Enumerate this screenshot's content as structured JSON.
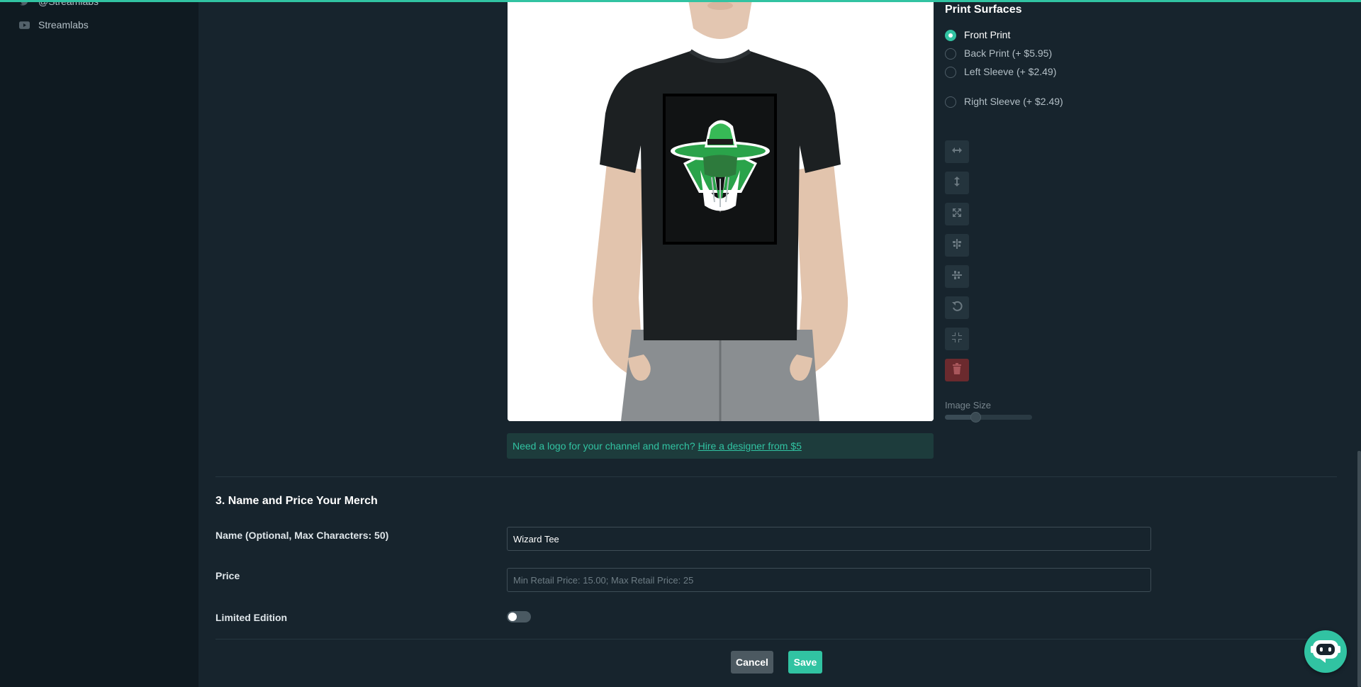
{
  "sidebar": {
    "links": [
      {
        "label": "@Streamlabs",
        "icon": "twitter-icon"
      },
      {
        "label": "Streamlabs",
        "icon": "youtube-icon"
      }
    ]
  },
  "print_surfaces": {
    "title": "Print Surfaces",
    "options": [
      {
        "label": "Front Print",
        "selected": true
      },
      {
        "label": "Back Print (+ $5.95)",
        "selected": false
      },
      {
        "label": "Left Sleeve (+ $2.49)",
        "selected": false
      },
      {
        "label": "Right Sleeve (+ $2.49)",
        "selected": false
      }
    ]
  },
  "toolbar": {
    "tools": [
      "stretch-horizontal-icon",
      "stretch-vertical-icon",
      "expand-icon",
      "align-vertical-center-icon",
      "align-horizontal-center-icon",
      "rotate-icon",
      "compress-icon",
      "trash-icon"
    ]
  },
  "image_size": {
    "label": "Image Size",
    "value": 0.36
  },
  "banner": {
    "text": "Need a logo for your channel and merch?",
    "link": "Hire a designer from $5"
  },
  "section": {
    "title": "3. Name and Price Your Merch",
    "name_label": "Name (Optional, Max Characters: 50)",
    "name_value": "Wizard Tee",
    "price_label": "Price",
    "price_placeholder": "Min Retail Price: 15.00; Max Retail Price: 25",
    "limited_label": "Limited Edition",
    "limited_on": false
  },
  "actions": {
    "cancel": "Cancel",
    "save": "Save"
  },
  "colors": {
    "accent": "#31c3a2",
    "background": "#17242d",
    "sidebar": "#0f1a21",
    "danger": "#6b2a2e"
  }
}
